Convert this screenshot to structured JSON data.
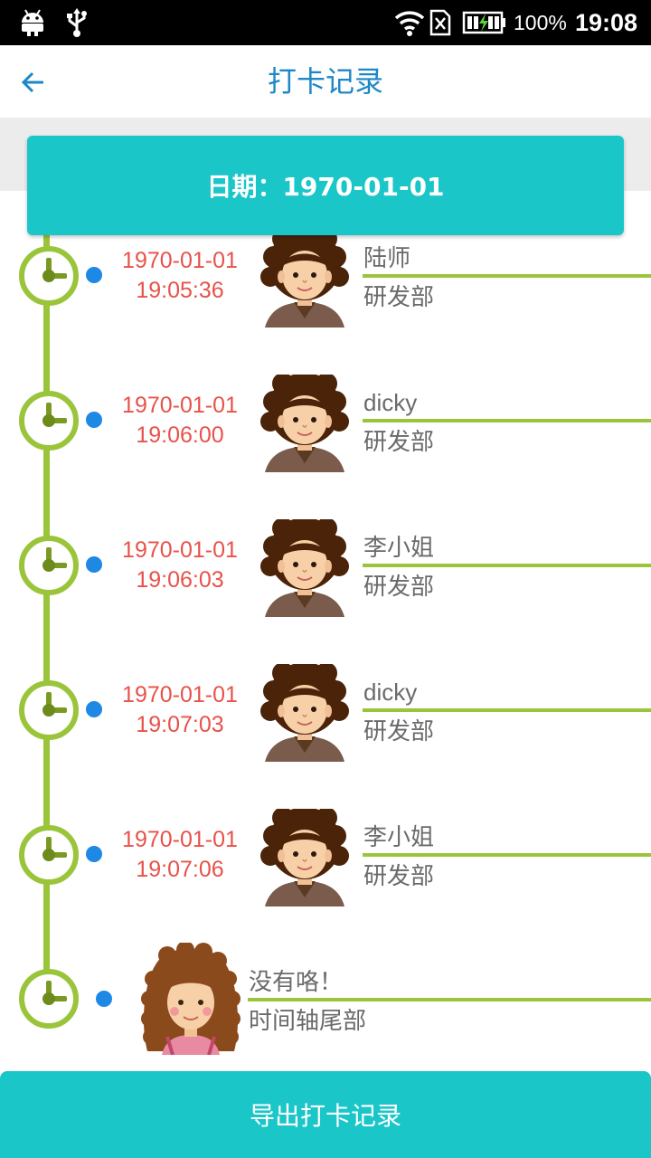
{
  "status_bar": {
    "battery": "100%",
    "time": "19:08",
    "icons": [
      "android-icon",
      "usb-icon",
      "wifi-icon",
      "no-sim-icon",
      "battery-charging-icon"
    ]
  },
  "toolbar": {
    "title": "打卡记录",
    "back_icon": "arrow-left-icon"
  },
  "date_card": {
    "label": "日期：1970-01-01"
  },
  "colors": {
    "accent_teal": "#1bc6c8",
    "title_blue": "#1e88c7",
    "timeline_green": "#9ac53b",
    "timestamp_red": "#e8524a",
    "dot_blue": "#1e88e5"
  },
  "records": [
    {
      "date": "1970-01-01",
      "time": "19:05:36",
      "name": "陆师",
      "dept": "研发部"
    },
    {
      "date": "1970-01-01",
      "time": "19:06:00",
      "name": "dicky",
      "dept": "研发部"
    },
    {
      "date": "1970-01-01",
      "time": "19:06:03",
      "name": "李小姐",
      "dept": "研发部"
    },
    {
      "date": "1970-01-01",
      "time": "19:07:03",
      "name": "dicky",
      "dept": "研发部"
    },
    {
      "date": "1970-01-01",
      "time": "19:07:06",
      "name": "李小姐",
      "dept": "研发部"
    }
  ],
  "tail": {
    "title": "没有咯！",
    "subtitle": "时间轴尾部"
  },
  "export_button": {
    "label": "导出打卡记录"
  }
}
